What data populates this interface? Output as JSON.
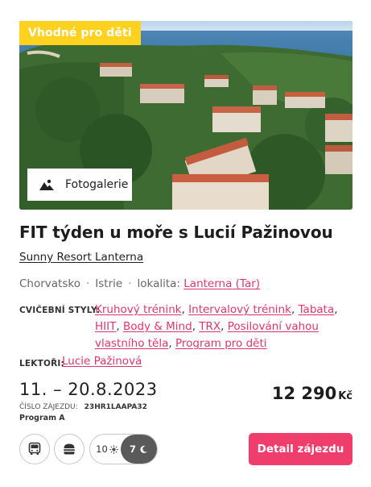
{
  "badge": "Vhodné pro děti",
  "gallery_button": "Fotogalerie",
  "title": "FIT týden u moře s Lucií Pažinovou",
  "resort": "Sunny Resort Lanterna",
  "location": {
    "country": "Chorvatsko",
    "region": "Istrie",
    "locality_label": "lokalita:",
    "locality": "Lanterna (Tar)",
    "separator": "·"
  },
  "styles": {
    "label": "CVIČEBNÍ STYLY:",
    "items": [
      "Kruhový trénink",
      "Intervalový trénink",
      "Tabata",
      "HIIT",
      "Body & Mind",
      "TRX",
      "Posilování vahou vlastního těla",
      "Program pro děti"
    ]
  },
  "lectors": {
    "label": "LEKTOŘI:",
    "name": "Lucie Pažinová"
  },
  "dates": "11. – 20.8.2023",
  "code_label": "ČÍSLO ZÁJEZDU:",
  "code": "23HR1LAAPA32",
  "program": "Program A",
  "price": "12 290",
  "currency": "Kč",
  "icons": {
    "transport": "bus-icon",
    "food": "burger-icon",
    "days": "sun-icon",
    "nights": "moon-icon"
  },
  "days": "10",
  "nights": "7",
  "detail_button": "Detail zájezdu",
  "colors": {
    "accent": "#ef3d6c",
    "badge": "#ffd21f",
    "link": "#e0356b"
  }
}
